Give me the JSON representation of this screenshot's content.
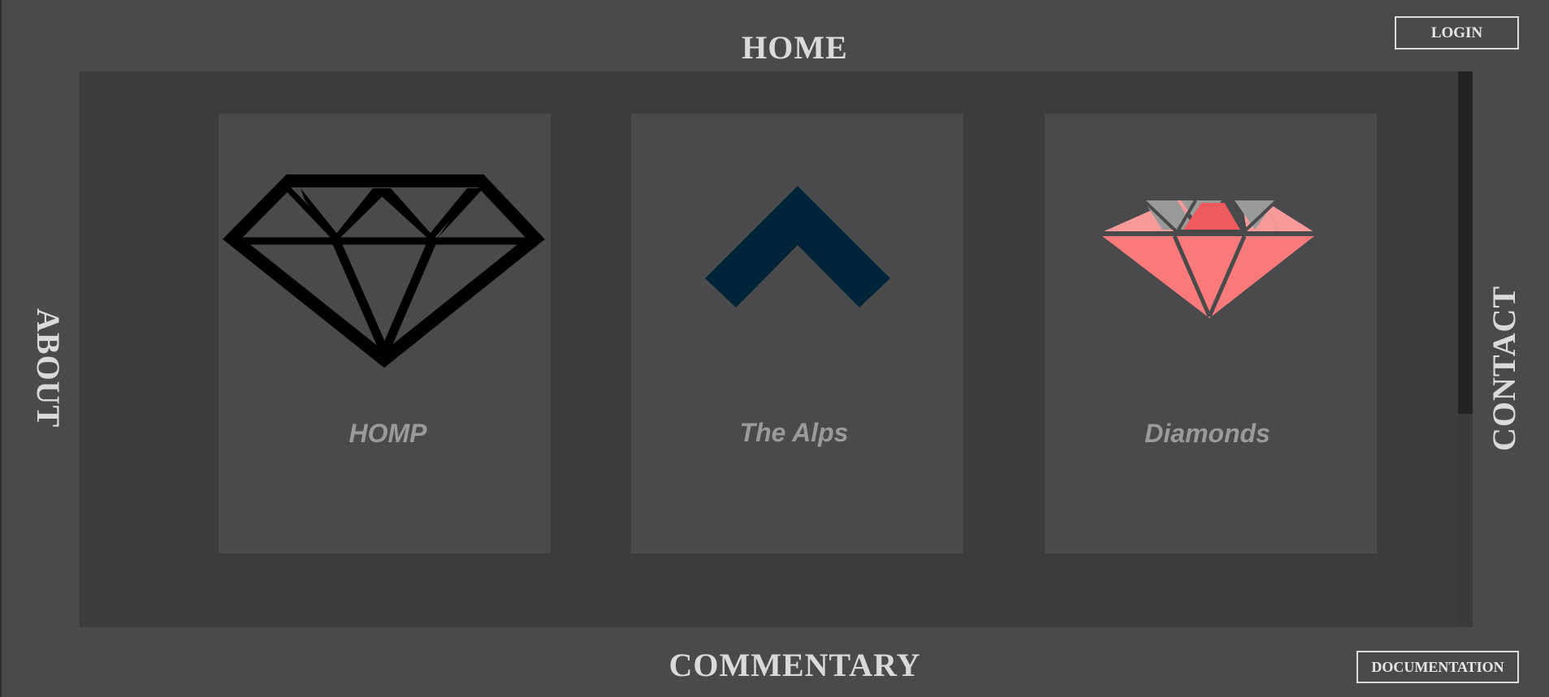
{
  "nav": {
    "home": "HOME",
    "about": "ABOUT",
    "contact": "CONTACT",
    "commentary": "COMMENTARY"
  },
  "buttons": {
    "login": "LOGIN",
    "documentation": "DOCUMENTATION"
  },
  "cards": [
    {
      "title": "HOMP",
      "icon": "diamond-outline-icon"
    },
    {
      "title": "The Alps",
      "icon": "chevron-up-icon"
    },
    {
      "title": "Diamonds",
      "icon": "diamond-colored-icon"
    }
  ],
  "colors": {
    "background": "#4a4a4c",
    "panel": "#3c3c3e",
    "card": "#4a4a4c",
    "nav_text": "#dadada",
    "card_title": "#9a9a9c",
    "chevron": "#002438",
    "diamond_coral": "#f87a7a"
  }
}
